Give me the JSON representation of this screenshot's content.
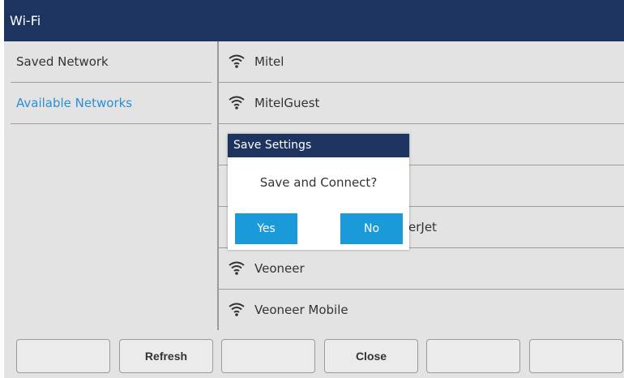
{
  "titlebar": {
    "title": "Wi-Fi"
  },
  "sidebar": {
    "items": [
      {
        "label": "Saved Network",
        "active": false
      },
      {
        "label": "Available Networks",
        "active": true
      }
    ],
    "active_color": "#2b8fd4"
  },
  "networks": [
    {
      "name": "Mitel",
      "icon": "wifi-signal-icon"
    },
    {
      "name": "MitelGuest",
      "icon": "wifi-signal-icon"
    },
    {
      "name": "",
      "icon": "wifi-signal-icon"
    },
    {
      "name": "",
      "icon": "wifi-signal-icon"
    },
    {
      "name": "erJet",
      "icon": "wifi-signal-icon"
    },
    {
      "name": "Veoneer",
      "icon": "wifi-signal-icon"
    },
    {
      "name": "Veoneer Mobile",
      "icon": "wifi-signal-icon"
    }
  ],
  "softkeys": [
    {
      "label": ""
    },
    {
      "label": "Refresh"
    },
    {
      "label": ""
    },
    {
      "label": "Close"
    },
    {
      "label": ""
    },
    {
      "label": ""
    }
  ],
  "dialog": {
    "title": "Save Settings",
    "message": "Save and Connect?",
    "yes_label": "Yes",
    "no_label": "No",
    "button_color": "#1a9ad9"
  },
  "colors": {
    "header": "#1d3461",
    "background": "#e3e3e3"
  }
}
